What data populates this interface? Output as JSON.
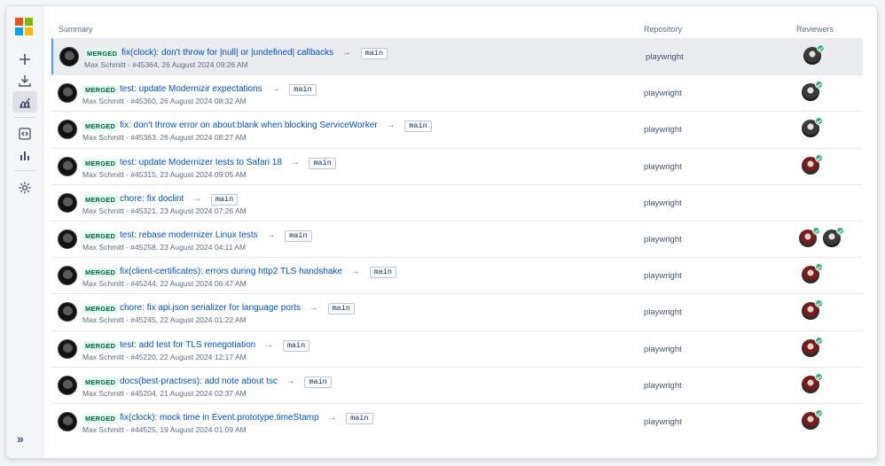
{
  "header": {
    "summary": "Summary",
    "repository": "Repository",
    "reviewers": "Reviewers"
  },
  "colors": {
    "merged_bg": "#e3fcef",
    "merged_text": "#006644",
    "link": "#0052cc",
    "selected": "#ebecf0",
    "accent": "#4c9aff"
  },
  "sidebar": {
    "logo": "microsoft-logo",
    "items": [
      {
        "name": "plus-icon"
      },
      {
        "name": "download-icon"
      },
      {
        "name": "chart-icon"
      },
      {
        "name": "code-icon"
      },
      {
        "name": "bar-chart-icon"
      },
      {
        "name": "gear-icon"
      }
    ],
    "expand_label": "»"
  },
  "rows": [
    {
      "badge": "MERGED",
      "title": "fix(clock): don't throw for |null| or |undefined| callbacks",
      "arrow": "→",
      "branch": "main",
      "meta": "Max Schmitt - #45364, 26 August 2024 09:26 AM",
      "repo": "playwright",
      "reviewers": [
        "gray"
      ]
    },
    {
      "badge": "MERGED",
      "title": "test: update Modernizir expectations",
      "arrow": "→",
      "branch": "main",
      "meta": "Max Schmitt - #45360, 26 August 2024 08:32 AM",
      "repo": "playwright",
      "reviewers": [
        "gray"
      ]
    },
    {
      "badge": "MERGED",
      "title": "fix: don't throw error on about:blank when blocking ServiceWorker",
      "arrow": "→",
      "branch": "main",
      "meta": "Max Schmitt - #45363, 26 August 2024 08:27 AM",
      "repo": "playwright",
      "reviewers": [
        "gray"
      ]
    },
    {
      "badge": "MERGED",
      "title": "test: update Modernizer tests to Safari 18",
      "arrow": "→",
      "branch": "main",
      "meta": "Max Schmitt - #45315, 23 August 2024 09:05 AM",
      "repo": "playwright",
      "reviewers": [
        "red"
      ]
    },
    {
      "badge": "MERGED",
      "title": "chore: fix doclint",
      "arrow": "→",
      "branch": "main",
      "meta": "Max Schmitt - #45321, 23 August 2024 07:26 AM",
      "repo": "playwright",
      "reviewers": []
    },
    {
      "badge": "MERGED",
      "title": "test: rebase modernizer Linux tests",
      "arrow": "→",
      "branch": "main",
      "meta": "Max Schmitt - #45258, 23 August 2024 04:11 AM",
      "repo": "playwright",
      "reviewers": [
        "red",
        "gray"
      ]
    },
    {
      "badge": "MERGED",
      "title": "fix(client-certificates): errors during http2 TLS handshake",
      "arrow": "→",
      "branch": "main",
      "meta": "Max Schmitt - #45244, 22 August 2024 06:47 AM",
      "repo": "playwright",
      "reviewers": [
        "red"
      ]
    },
    {
      "badge": "MERGED",
      "title": "chore: fix api.json serializer for language ports",
      "arrow": "→",
      "branch": "main",
      "meta": "Max Schmitt - #45245, 22 August 2024 01:22 AM",
      "repo": "playwright",
      "reviewers": [
        "red"
      ]
    },
    {
      "badge": "MERGED",
      "title": "test: add test for TLS renegotiation",
      "arrow": "→",
      "branch": "main",
      "meta": "Max Schmitt - #45220, 22 August 2024 12:17 AM",
      "repo": "playwright",
      "reviewers": [
        "red"
      ]
    },
    {
      "badge": "MERGED",
      "title": "docs(best-practises): add note about tsc",
      "arrow": "→",
      "branch": "main",
      "meta": "Max Schmitt - #45204, 21 August 2024 02:37 AM",
      "repo": "playwright",
      "reviewers": [
        "red"
      ]
    },
    {
      "badge": "MERGED",
      "title": "fix(clock): mock time in Event.prototype.timeStamp",
      "arrow": "→",
      "branch": "main",
      "meta": "Max Schmitt - #44525, 19 August 2024 01:09 AM",
      "repo": "playwright",
      "reviewers": [
        "red"
      ]
    }
  ]
}
